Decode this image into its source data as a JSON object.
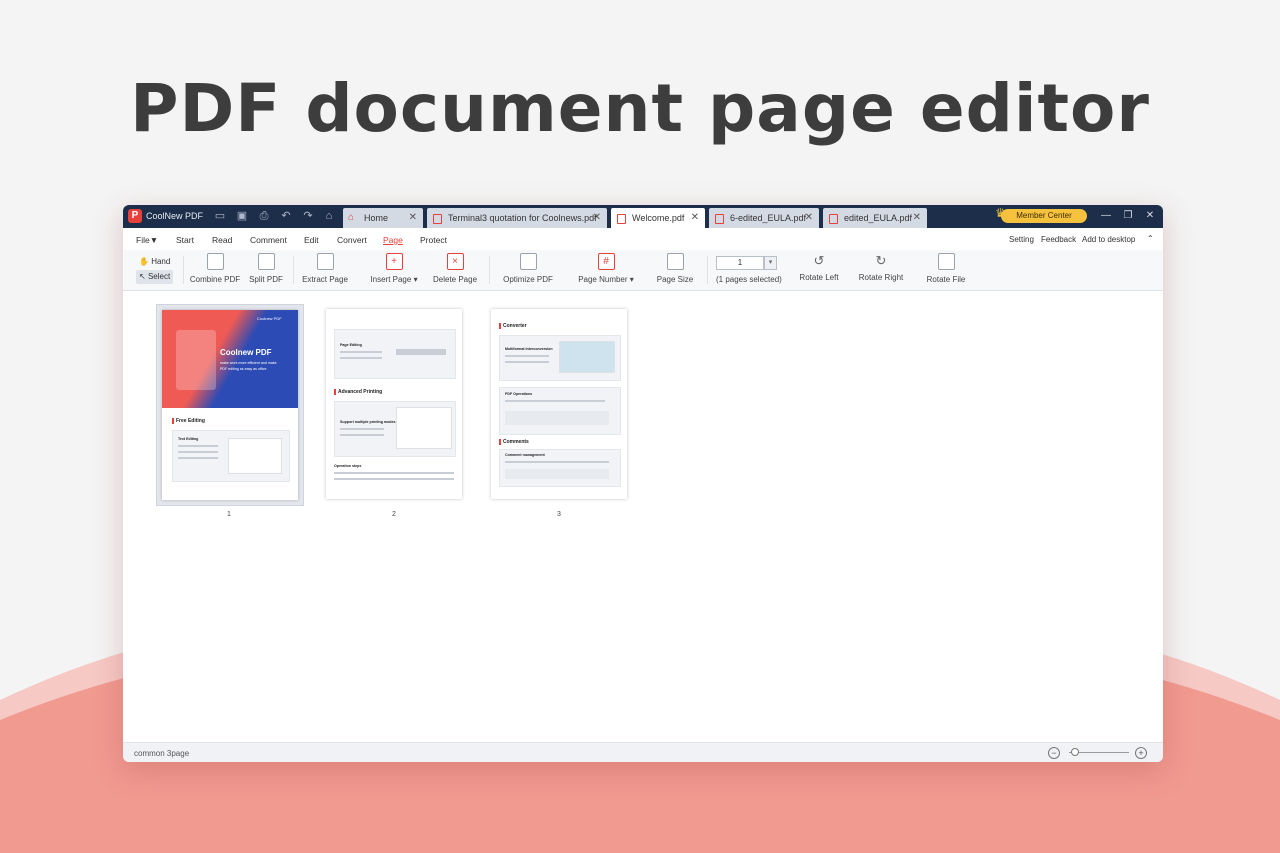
{
  "headline": "PDF document page editor",
  "colors": {
    "accent": "#e6413a",
    "titlebar": "#1c2e4a",
    "member_badge": "#f6c23e",
    "wave": "#f19a90"
  },
  "app": {
    "logo": "P",
    "name": "CoolNew PDF"
  },
  "quick_access_icons": [
    "open-folder-icon",
    "save-icon",
    "print-icon",
    "undo-icon",
    "redo-icon",
    "home-circle-icon"
  ],
  "tabs": [
    {
      "label": "Home",
      "icon": "home-icon",
      "active": false
    },
    {
      "label": "Terminal3 quotation for Coolnews.pdf",
      "icon": "pdf-file-icon",
      "active": false
    },
    {
      "label": "Welcome.pdf",
      "icon": "pdf-file-icon",
      "active": true
    },
    {
      "label": "6-edited_EULA.pdf",
      "icon": "pdf-file-icon",
      "active": false
    },
    {
      "label": "edited_EULA.pdf",
      "icon": "pdf-file-icon",
      "active": false
    }
  ],
  "tab_close": "✕",
  "member_center": "Member Center",
  "window_controls": {
    "minimize": "—",
    "restore": "❐",
    "close": "✕"
  },
  "menu": {
    "file": "File▼",
    "items": [
      "Start",
      "Read",
      "Comment",
      "Edit",
      "Convert",
      "Page",
      "Protect"
    ],
    "active": "Page",
    "right": [
      "Setting",
      "Feedback",
      "Add to desktop"
    ],
    "collapse": "⌃"
  },
  "toolbar": {
    "hand": "Hand",
    "select": "Select",
    "combine_pdf": "Combine PDF",
    "split_pdf": "Split PDF",
    "extract_page": "Extract Page",
    "insert_page": "Insert Page",
    "delete_page": "Delete Page",
    "optimize_pdf": "Optimize PDF",
    "page_number": "Page Number",
    "page_size": "Page Size",
    "page_input": "1",
    "pages_selected": "(1 pages selected)",
    "rotate_left": "Rotate Left",
    "rotate_right": "Rotate Right",
    "rotate_file": "Rotate File",
    "dropdown_arrow": "▾"
  },
  "pages": [
    {
      "number": "1",
      "selected": true,
      "cover_brand": "Coolnew PDF",
      "cover_title": "Coolnew PDF",
      "cover_sub1": "make work more efficient and make",
      "cover_sub2": "PDF editing as easy as office",
      "section": "Free Editing",
      "card_title": "Text Editing"
    },
    {
      "number": "2",
      "selected": false,
      "card_title": "Page Editing",
      "section": "Advanced Printing",
      "card2_title": "Support multiple printing modes",
      "footer_title": "Operation steps"
    },
    {
      "number": "3",
      "selected": false,
      "section": "Converter",
      "card_title": "Multiformat Interconversion",
      "card2_title": "PDF Operations",
      "section2": "Comments",
      "card3_title": "Comment management"
    }
  ],
  "status": {
    "text": "common 3page",
    "zoom_out": "−",
    "zoom_in": "+"
  }
}
